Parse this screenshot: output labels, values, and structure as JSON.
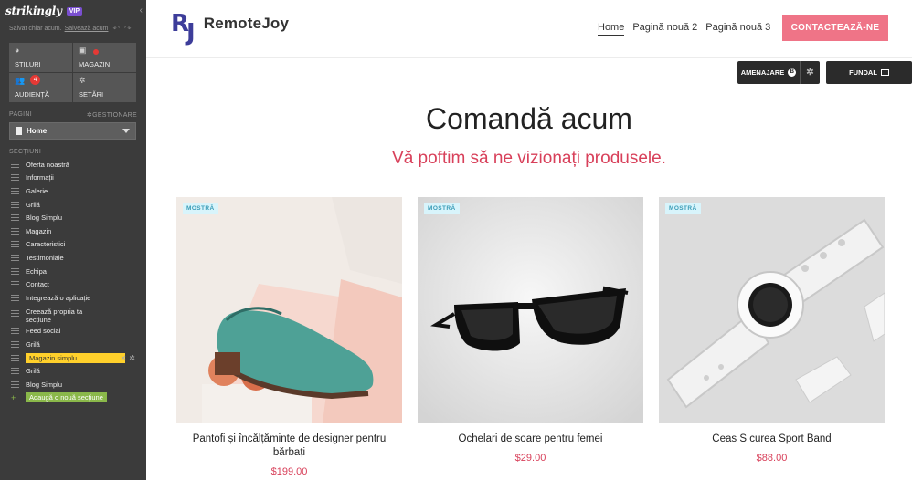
{
  "sidebar": {
    "logo": "strikingly",
    "vip": "VIP",
    "saved_text": "Salvat chiar acum.",
    "save_link": "Salvează acum",
    "tiles": [
      {
        "label": "STILURI",
        "icon": "palette-icon"
      },
      {
        "label": "MAGAZIN",
        "icon": "shopping-bag-icon"
      },
      {
        "label": "AUDIENȚĂ",
        "icon": "users-icon",
        "badge": "4"
      },
      {
        "label": "SETĂRI",
        "icon": "gear-icon"
      }
    ],
    "pages_label": "PAGINI",
    "manage_label": "GESTIONARE",
    "current_page": "Home",
    "sections_label": "SECȚIUNI",
    "sections": [
      "Oferta noastră",
      "Informații",
      "Galerie",
      "Grilă",
      "Blog Simplu",
      "Magazin",
      "Caracteristici",
      "Testimoniale",
      "Echipa",
      "Contact",
      "Integrează o aplicație",
      "Creează propria ta secțiune",
      "Feed social",
      "Grilă",
      "Magazin simplu",
      "Grilă",
      "Blog Simplu"
    ],
    "active_section_index": 14,
    "add_section": "Adaugă o nouă secțiune"
  },
  "site": {
    "brand_mark": "RJ",
    "brand_name": "RemoteJoy",
    "nav": [
      "Home",
      "Pagină nouă 2",
      "Pagină nouă 3"
    ],
    "cta": "CONTACTEAZĂ-NE",
    "editor_buttons": {
      "layout": "AMENAJARE",
      "layout_badge": "B",
      "background": "FUNDAL"
    },
    "section_title": "Comandă acum",
    "section_subtitle": "Vă poftim să ne vizionați produsele.",
    "sample_badge": "MOSTRĂ",
    "products": [
      {
        "name": "Pantofi și încălțăminte de designer pentru bărbați",
        "price": "$199.00"
      },
      {
        "name": "Ochelari de soare pentru femei",
        "price": "$29.00"
      },
      {
        "name": "Ceas S curea Sport Band",
        "price": "$88.00"
      }
    ]
  },
  "colors": {
    "sidebar_bg": "#3b3b3b",
    "accent_pink": "#ef7487",
    "price_red": "#d8405a",
    "brand_blue": "#3d3d9a",
    "active_yellow": "#ffd02b",
    "add_green": "#8ab84a"
  }
}
